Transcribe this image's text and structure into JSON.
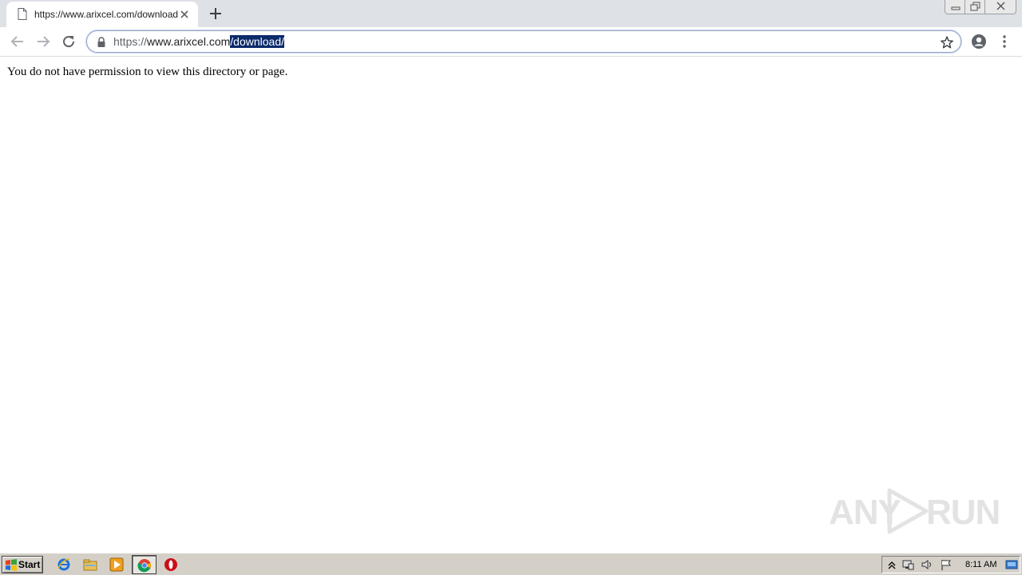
{
  "browser": {
    "tab": {
      "title": "https://www.arixcel.com/download/"
    },
    "address_bar": {
      "url_scheme": "https://",
      "url_host": "www.arixcel.com",
      "url_path_selected": "/download/"
    }
  },
  "page": {
    "message": "You do not have permission to view this directory or page."
  },
  "watermark": {
    "left": "ANY",
    "right": "RUN"
  },
  "taskbar": {
    "start_label": "Start",
    "clock": "8:11 AM"
  },
  "colors": {
    "selection": "#0b2a6b",
    "chrome_bg": "#dee1e6",
    "taskbar_bg": "#d4d0c8"
  }
}
